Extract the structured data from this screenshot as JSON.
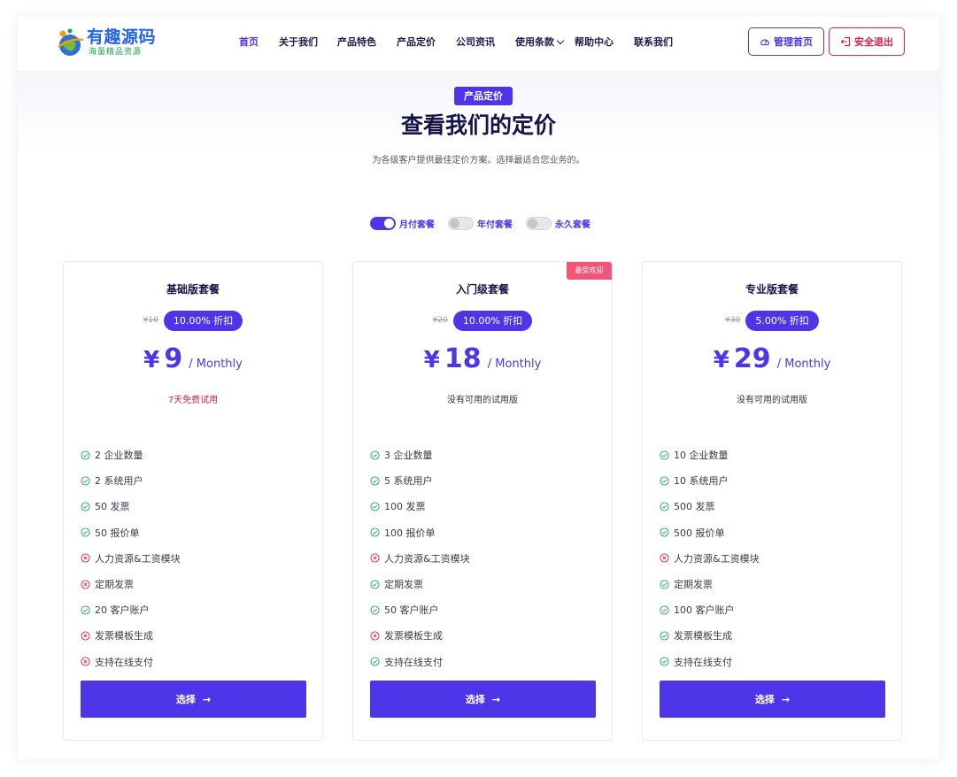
{
  "brand": {
    "title": "有趣源码",
    "subtitle": "海量精品资源"
  },
  "nav": {
    "items": [
      {
        "label": "首页",
        "active": true
      },
      {
        "label": "关于我们"
      },
      {
        "label": "产品特色"
      },
      {
        "label": "产品定价"
      },
      {
        "label": "公司资讯"
      },
      {
        "label": "使用条款",
        "dropdown": true
      },
      {
        "label": "帮助中心"
      },
      {
        "label": "联系我们"
      }
    ],
    "admin_label": "管理首页",
    "logout_label": "安全退出"
  },
  "header": {
    "tag": "产品定价",
    "title": "查看我们的定价",
    "subtitle": "为各级客户提供最佳定价方案。选择最适合您业务的。"
  },
  "billing_toggles": [
    {
      "label": "月付套餐",
      "on": true
    },
    {
      "label": "年付套餐",
      "on": false
    },
    {
      "label": "永久套餐",
      "on": false
    }
  ],
  "plans": [
    {
      "name": "基础版套餐",
      "old_price": "¥10",
      "discount": "10.00% 折扣",
      "currency": "¥",
      "price": "9",
      "period": "/ Monthly",
      "trial": "7天免费试用",
      "trial_free": true,
      "features": [
        {
          "text": "2 企业数量",
          "ok": true
        },
        {
          "text": "2 系统用户",
          "ok": true
        },
        {
          "text": "50 发票",
          "ok": true
        },
        {
          "text": "50 报价单",
          "ok": true
        },
        {
          "text": "人力资源&工资模块",
          "ok": false
        },
        {
          "text": "定期发票",
          "ok": false
        },
        {
          "text": "20 客户账户",
          "ok": true
        },
        {
          "text": "发票模板生成",
          "ok": false
        },
        {
          "text": "支持在线支付",
          "ok": false
        }
      ],
      "button": "选择"
    },
    {
      "name": "入门级套餐",
      "badge": "最受欢迎",
      "old_price": "¥20",
      "discount": "10.00% 折扣",
      "currency": "¥",
      "price": "18",
      "period": "/ Monthly",
      "trial": "没有可用的试用版",
      "trial_free": false,
      "features": [
        {
          "text": "3 企业数量",
          "ok": true
        },
        {
          "text": "5 系统用户",
          "ok": true
        },
        {
          "text": "100 发票",
          "ok": true
        },
        {
          "text": "100 报价单",
          "ok": true
        },
        {
          "text": "人力资源&工资模块",
          "ok": false
        },
        {
          "text": "定期发票",
          "ok": true
        },
        {
          "text": "50 客户账户",
          "ok": true
        },
        {
          "text": "发票模板生成",
          "ok": false
        },
        {
          "text": "支持在线支付",
          "ok": true
        }
      ],
      "button": "选择"
    },
    {
      "name": "专业版套餐",
      "old_price": "¥30",
      "discount": "5.00% 折扣",
      "currency": "¥",
      "price": "29",
      "period": "/ Monthly",
      "trial": "没有可用的试用版",
      "trial_free": false,
      "features": [
        {
          "text": "10 企业数量",
          "ok": true
        },
        {
          "text": "10 系统用户",
          "ok": true
        },
        {
          "text": "500 发票",
          "ok": true
        },
        {
          "text": "500 报价单",
          "ok": true
        },
        {
          "text": "人力资源&工资模块",
          "ok": false
        },
        {
          "text": "定期发票",
          "ok": true
        },
        {
          "text": "100 客户账户",
          "ok": true
        },
        {
          "text": "发票模板生成",
          "ok": true
        },
        {
          "text": "支持在线支付",
          "ok": true
        }
      ],
      "button": "选择"
    }
  ],
  "colors": {
    "accent": "#4f35e8",
    "danger": "#e11d48",
    "check": "#22a06b",
    "ribbon": "#f2557a",
    "title": "#141446"
  }
}
